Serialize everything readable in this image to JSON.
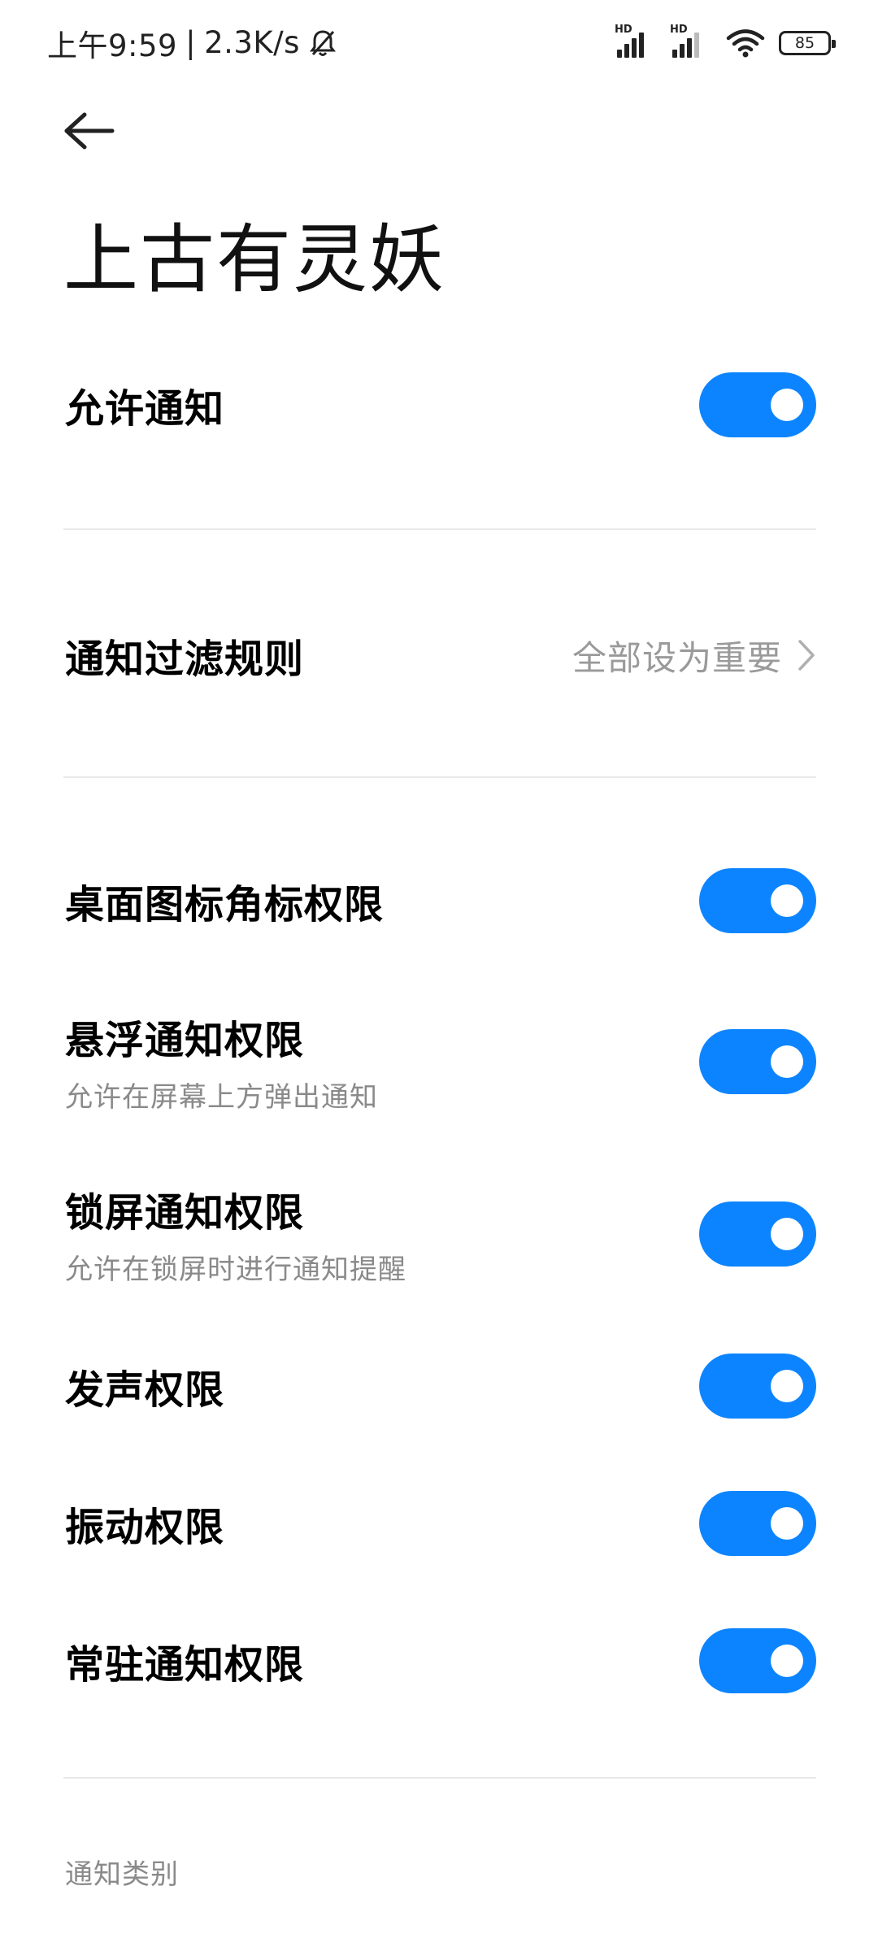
{
  "status_bar": {
    "time": "上午9:59",
    "separator": "|",
    "network_speed": "2.3K/s",
    "signal_label_1": "HD",
    "signal_label_2": "HD",
    "battery": "85",
    "icons": [
      "bell-off-icon",
      "signal-icon",
      "signal-icon",
      "wifi-icon",
      "battery-icon"
    ]
  },
  "header": {
    "back_icon": "arrow-left-icon",
    "title": "上古有灵妖"
  },
  "settings": {
    "allow_notifications": {
      "label": "允许通知",
      "enabled": true
    },
    "filter_rule": {
      "label": "通知过滤规则",
      "value": "全部设为重要"
    },
    "badge_permission": {
      "label": "桌面图标角标权限",
      "enabled": true
    },
    "floating_permission": {
      "label": "悬浮通知权限",
      "sub": "允许在屏幕上方弹出通知",
      "enabled": true
    },
    "lockscreen_permission": {
      "label": "锁屏通知权限",
      "sub": "允许在锁屏时进行通知提醒",
      "enabled": true
    },
    "sound_permission": {
      "label": "发声权限",
      "enabled": true
    },
    "vibration_permission": {
      "label": "振动权限",
      "enabled": true
    },
    "persistent_permission": {
      "label": "常驻通知权限",
      "enabled": true
    }
  },
  "section": {
    "categories_header": "通知类别"
  },
  "colors": {
    "accent": "#0d84ff",
    "secondary_text": "#8a8a8a",
    "divider": "#e9e9e9"
  }
}
